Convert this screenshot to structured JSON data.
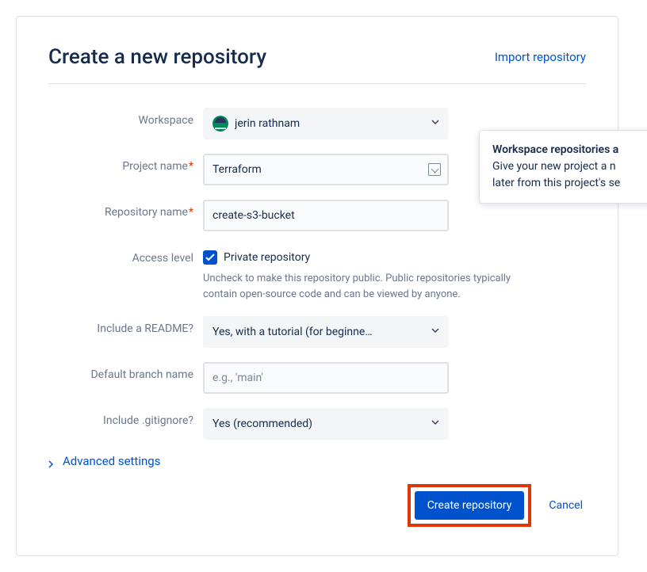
{
  "header": {
    "title": "Create a new repository",
    "import_link": "Import repository"
  },
  "labels": {
    "workspace": "Workspace",
    "project_name": "Project name",
    "repository_name": "Repository name",
    "access_level": "Access level",
    "include_readme": "Include a README?",
    "default_branch": "Default branch name",
    "include_gitignore": "Include .gitignore?"
  },
  "fields": {
    "workspace_selected": "jerin rathnam",
    "project_name_value": "Terraform",
    "repository_name_value": "create-s3-bucket",
    "private_checkbox_label": "Private repository",
    "private_helper": "Uncheck to make this repository public. Public repositories typically contain open-source code and can be viewed by anyone.",
    "readme_selected": "Yes, with a tutorial (for beginne…",
    "default_branch_placeholder": "e.g., 'main'",
    "gitignore_selected": "Yes (recommended)"
  },
  "advanced_settings": "Advanced settings",
  "actions": {
    "create": "Create repository",
    "cancel": "Cancel"
  },
  "tooltip": {
    "title": "Workspace repositories a",
    "body_line1": "Give your new project a n",
    "body_line2": "later from this project's se"
  }
}
